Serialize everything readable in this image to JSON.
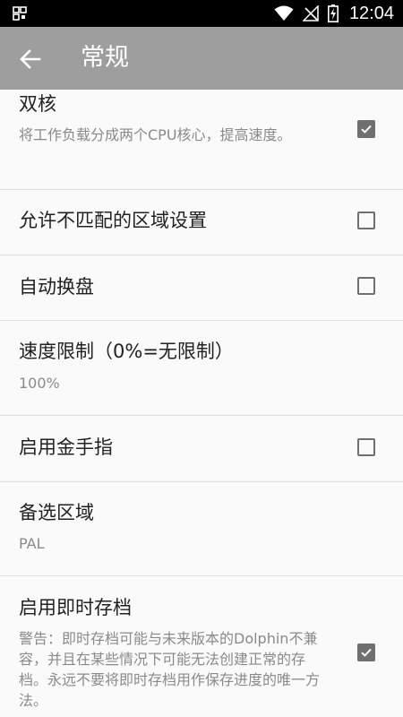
{
  "status_bar": {
    "time": "12:04",
    "icons": [
      "dual-sim-icon",
      "wifi-icon",
      "no-signal-icon",
      "battery-charging-icon"
    ]
  },
  "app_bar": {
    "back_icon": "arrow-left-icon",
    "title": "常规"
  },
  "settings": [
    {
      "key": "dual_core",
      "title": "双核",
      "summary": "将工作负载分成两个CPU核心，提高速度。",
      "type": "checkbox",
      "checked": true
    },
    {
      "key": "region_mismatch",
      "title": "允许不匹配的区域设置",
      "type": "checkbox",
      "checked": false
    },
    {
      "key": "auto_disc_change",
      "title": "自动换盘",
      "type": "checkbox",
      "checked": false
    },
    {
      "key": "speed_limit",
      "title": "速度限制（0%=无限制）",
      "value": "100%",
      "type": "value"
    },
    {
      "key": "cheats",
      "title": "启用金手指",
      "type": "checkbox",
      "checked": false
    },
    {
      "key": "fallback_region",
      "title": "备选区域",
      "value": "PAL",
      "type": "value"
    },
    {
      "key": "savestates",
      "title": "启用即时存档",
      "summary": "警告：即时存档可能与未来版本的Dolphin不兼容，并且在某些情况下可能无法创建正常的存档。永远不要将即时存档用作保存进度的唯一方法。",
      "type": "checkbox",
      "checked": true
    }
  ],
  "colors": {
    "status_bar_bg": "#000000",
    "app_bar_bg": "#9e9e9e",
    "page_bg": "#fafafa",
    "title_text": "#212121",
    "summary_text": "#8a8a8a",
    "checkbox": "#6f6f6f",
    "divider": "#e0e0e0"
  }
}
